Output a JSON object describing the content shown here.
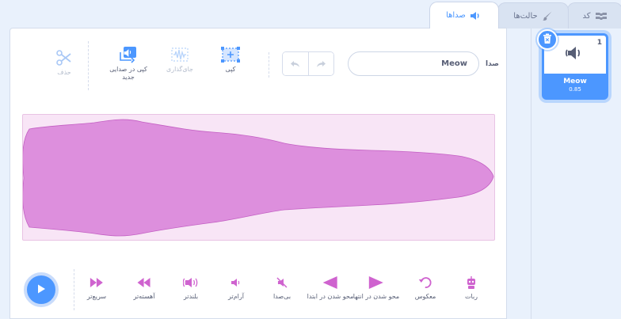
{
  "tabs": {
    "code": "کد",
    "costumes": "حالت‌ها",
    "sounds": "صداها"
  },
  "editor": {
    "sound_label": "صدا",
    "sound_name": "Meow",
    "tools": {
      "copy": "کپی",
      "paste": "جای‌گذاری",
      "copy_to_new": "کپی در صدایی جدید",
      "delete": "حذف"
    },
    "effects": {
      "faster": "سریع‌تر",
      "slower": "آهسته‌تر",
      "louder": "بلندتر",
      "softer": "آرام‌تر",
      "mute": "بی‌صدا",
      "fade_in": "محو شدن در ابتدا",
      "fade_out": "محو شدن در انتها",
      "reverse": "معکوس",
      "robot": "ربات"
    }
  },
  "sound_list": {
    "items": [
      {
        "number": "1",
        "name": "Meow",
        "duration": "0.85"
      }
    ]
  },
  "colors": {
    "accent": "#4c97ff",
    "waveform": "#cf63cf",
    "effect_icon": "#cf63cf"
  }
}
